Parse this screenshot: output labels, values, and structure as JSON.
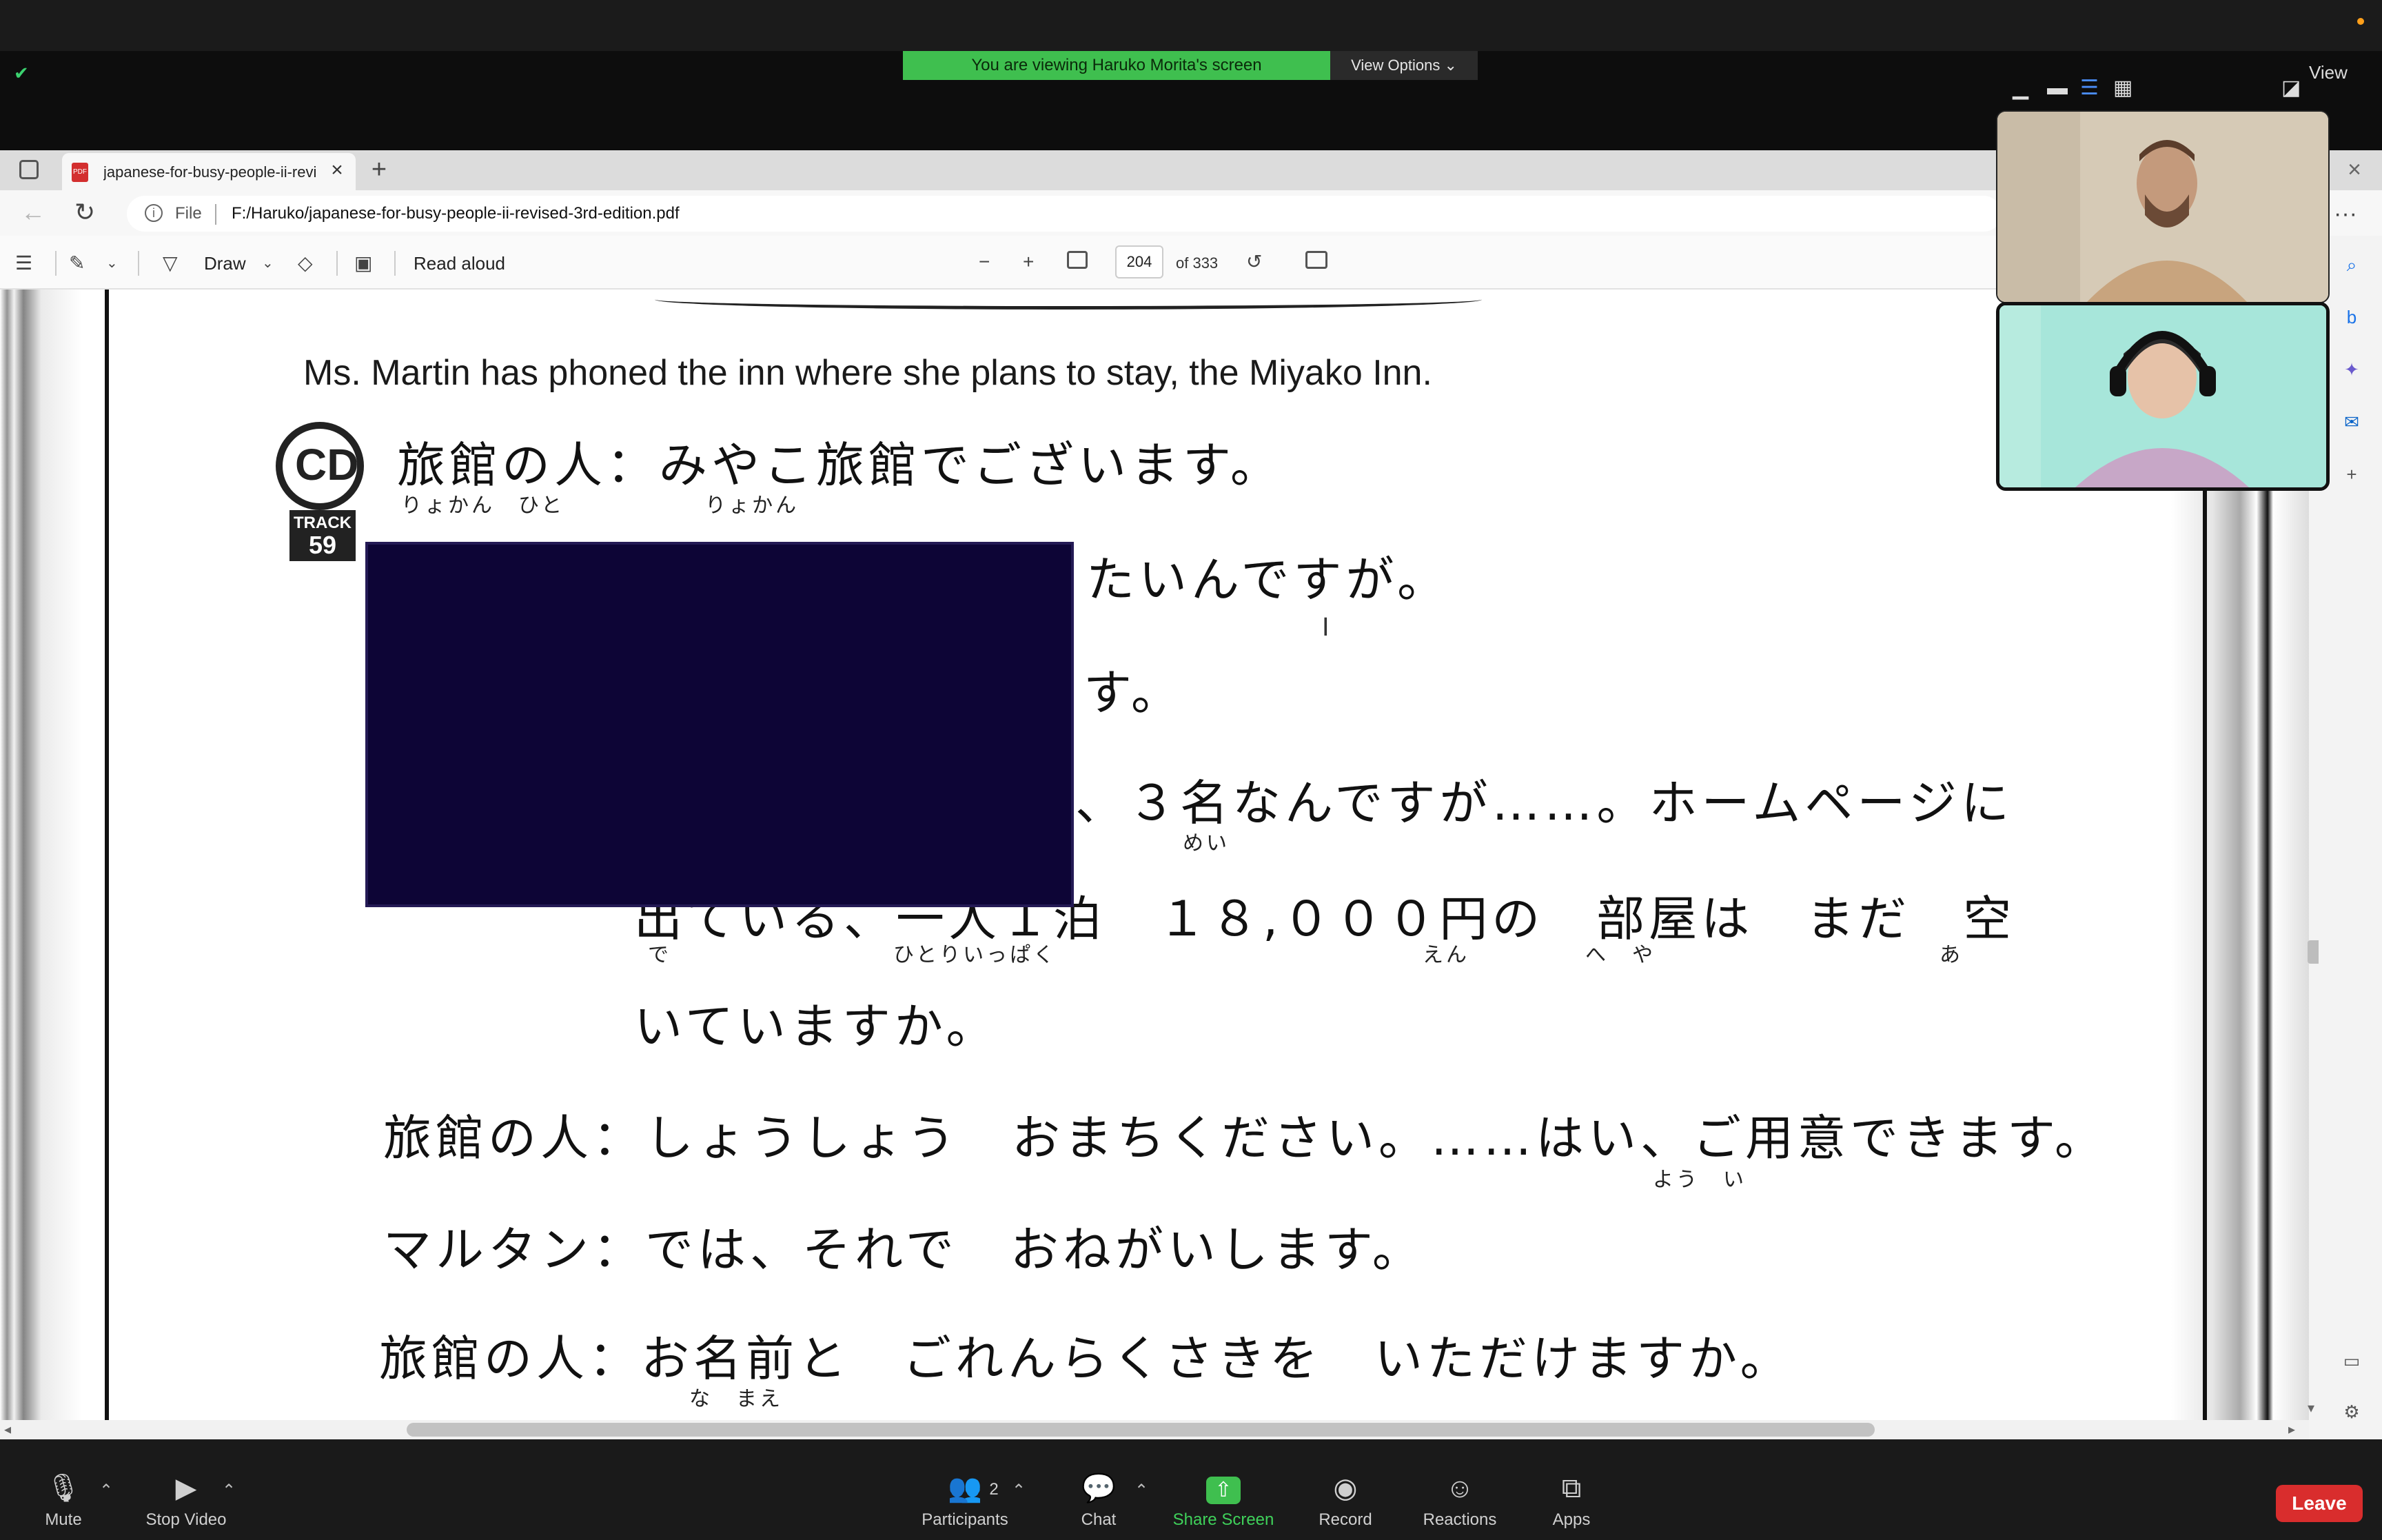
{
  "zoom": {
    "viewing_banner": "You are viewing Haruko Morita's screen",
    "view_options": "View Options ⌄",
    "view_label": "View",
    "participants_count": "2",
    "controls": {
      "mute": "Mute",
      "stop_video": "Stop Video",
      "participants": "Participants",
      "chat": "Chat",
      "share_screen": "Share Screen",
      "record": "Record",
      "reactions": "Reactions",
      "apps": "Apps",
      "leave": "Leave"
    },
    "colors": {
      "share_green": "#3fbf4f",
      "leave_red": "#d92d2d"
    }
  },
  "browser": {
    "tab_title": "japanese-for-busy-people-ii-revi",
    "url_prefix": "File",
    "url": "F:/Haruko/japanese-for-busy-people-ii-revised-3rd-edition.pdf"
  },
  "pdf_toolbar": {
    "draw_label": "Draw",
    "read_aloud_label": "Read aloud",
    "page_current": "204",
    "page_total": "of 333"
  },
  "page": {
    "intro_en": "Ms. Martin has phoned the inn where she plans to stay, the Miyako Inn.",
    "cd_label": "CD",
    "track_label": "TRACK",
    "track_number": "59",
    "lines": [
      {
        "text": "旅館の人：みやこ旅館でございます。",
        "furigana": "りょかん　ひと　　　　　　りょかん"
      },
      {
        "text": "たいんですが。"
      },
      {
        "text": "す。"
      },
      {
        "text": "、３名なんですが……。ホームページに",
        "furigana": "めい"
      },
      {
        "text": "出ている、一人１泊　１８,０００円の　部屋は　まだ　空",
        "furigana_parts": [
          "で",
          "ひとりいっぱく",
          "えん",
          "へ　や",
          "あ"
        ]
      },
      {
        "text": "いていますか。"
      },
      {
        "text": "旅館の人：しょうしょう　おまちください。……はい、ご用意できます。",
        "furigana": "よう　い"
      },
      {
        "text": "マルタン：では、それで　おねがいします。"
      },
      {
        "text": "旅館の人：お名前と　ごれんらくさきを　いただけますか。",
        "furigana": "な　まえ"
      }
    ]
  }
}
